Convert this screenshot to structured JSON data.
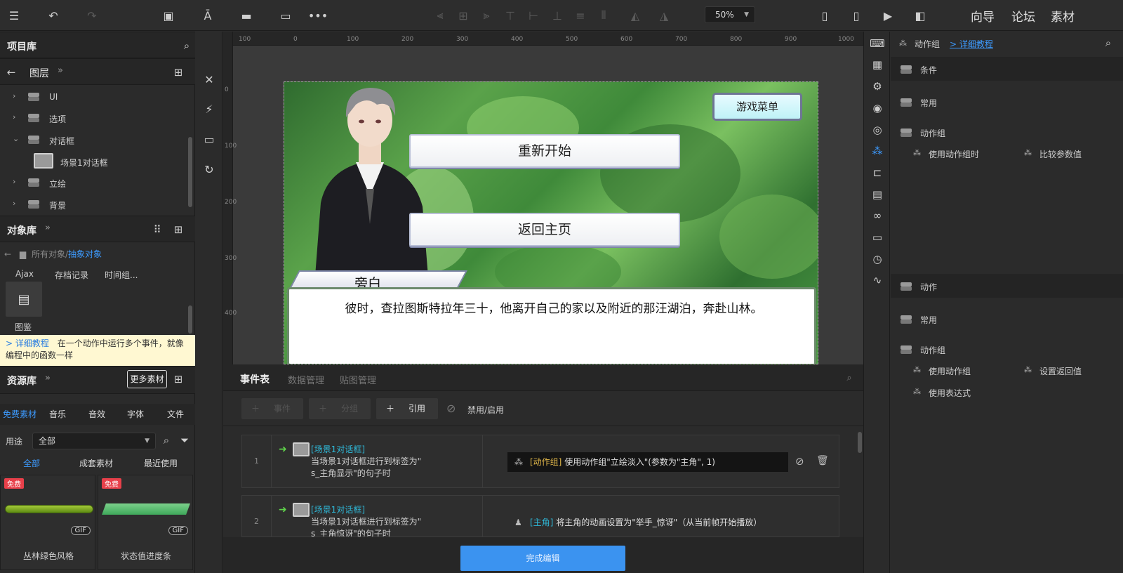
{
  "topbar": {
    "zoom": "50%",
    "links": [
      "向导",
      "论坛",
      "素材"
    ]
  },
  "project_lib": {
    "title": "项目库",
    "layers_label": "图层",
    "tree": [
      {
        "label": "UI",
        "expanded": false
      },
      {
        "label": "选项",
        "expanded": false
      },
      {
        "label": "对话框",
        "expanded": true
      },
      {
        "label": "场景1对话框",
        "child": true
      },
      {
        "label": "立绘",
        "expanded": false
      },
      {
        "label": "背景",
        "expanded": false
      }
    ]
  },
  "object_lib": {
    "title": "对象库",
    "breadcrumb_root": "所有对象",
    "breadcrumb_sep": "/",
    "breadcrumb_leaf": "抽象对象",
    "tabs": [
      "Ajax",
      "存档记录",
      "时间组..."
    ],
    "item_label": "图鉴"
  },
  "tip": {
    "link": "> 详细教程",
    "text": "在一个动作中运行多个事件，就像编程中的函数一样"
  },
  "resource_lib": {
    "title": "资源库",
    "more_button": "更多素材",
    "tabs": [
      "免费素材",
      "音乐",
      "音效",
      "字体",
      "文件"
    ],
    "usage_label": "用途",
    "usage_value": "全部",
    "sub_tabs": [
      "全部",
      "成套素材",
      "最近使用"
    ],
    "cards": [
      {
        "badge": "免费",
        "gif": "GIF",
        "label": "丛林绿色风格"
      },
      {
        "badge": "免费",
        "gif": "GIF",
        "label": "状态值进度条"
      }
    ]
  },
  "ruler": {
    "top": [
      "100",
      "0",
      "100",
      "200",
      "300",
      "400",
      "500",
      "600",
      "700",
      "800",
      "900",
      "1000"
    ],
    "left": [
      "0",
      "100",
      "200",
      "300",
      "400"
    ]
  },
  "game": {
    "menu_button": "游戏菜单",
    "restart_button": "重新开始",
    "home_button": "返回主页",
    "speaker": "旁白",
    "dialog_text": "彼时，查拉图斯特拉年三十，他离开自己的家以及附近的那汪湖泊，奔赴山林。"
  },
  "right_panel": {
    "header_title": "动作组",
    "header_link": "> 详细教程",
    "conditions": {
      "section": "条件",
      "common": "常用",
      "group": "动作组",
      "items": [
        "使用动作组时",
        "比较参数值"
      ]
    },
    "actions": {
      "section": "动作",
      "common": "常用",
      "group": "动作组",
      "items": [
        "使用动作组",
        "设置返回值",
        "使用表达式"
      ]
    }
  },
  "events": {
    "tabs": [
      "事件表",
      "数据管理",
      "贴图管理"
    ],
    "toolbar": {
      "event": "事件",
      "group": "分组",
      "ref": "引用",
      "toggle": "禁用/启用"
    },
    "rows": [
      {
        "num": "1",
        "cond_tag": "[场景1对话框]",
        "cond_line1": "当场景1对话框进行到标签为\"",
        "cond_line2": "s_主角显示\"的句子时",
        "act_tag": "[动作组]",
        "act_text": " 使用动作组\"立绘淡入\"(参数为\"主角\", 1)"
      },
      {
        "num": "2",
        "cond_tag": "[场景1对话框]",
        "cond_line1": "当场景1对话框进行到标签为\"",
        "cond_line2": "s_主角惊讶\"的句子时",
        "act_tag": "[主角]",
        "act_text": " 将主角的动画设置为\"举手_惊讶\"（从当前帧开始播放）"
      }
    ],
    "done_button": "完成编辑"
  }
}
